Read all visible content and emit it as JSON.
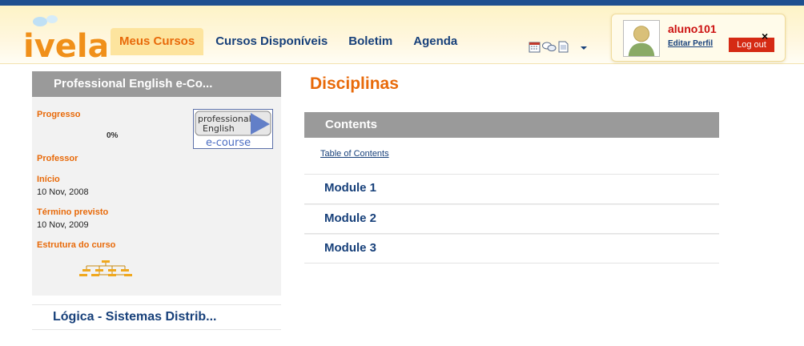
{
  "header": {
    "logo_text": "ivela",
    "nav": [
      {
        "label": "Meus Cursos",
        "active": true
      },
      {
        "label": "Cursos Disponíveis",
        "active": false
      },
      {
        "label": "Boletim",
        "active": false
      },
      {
        "label": "Agenda",
        "active": false
      }
    ],
    "tools": [
      "calendar-icon",
      "chat-icon",
      "document-icon",
      "dropdown-arrow-icon"
    ]
  },
  "user": {
    "name": "aluno101",
    "edit_profile": "Editar Perfil",
    "logout": "Log out",
    "close": "×"
  },
  "sidebar": {
    "course_title": "Professional English e-Co...",
    "course_logo": {
      "line1": "professional",
      "line2": "English",
      "line3": "e-course"
    },
    "progress_label": "Progresso",
    "progress_value": "0%",
    "teacher_label": "Professor",
    "start_label": "Início",
    "start_date": "10 Nov, 2008",
    "end_label": "Término previsto",
    "end_date": "10 Nov, 2009",
    "structure_label": "Estrutura do curso",
    "other_course": "Lógica - Sistemas Distrib..."
  },
  "main": {
    "title": "Disciplinas",
    "section": "Contents",
    "toc": "Table of Contents",
    "modules": [
      "Module 1",
      "Module 2",
      "Module 3"
    ]
  },
  "colors": {
    "brand_orange": "#e86a0a",
    "nav_blue": "#17407a",
    "logout_red": "#d52a14",
    "bar_gray": "#9a9a9a"
  }
}
